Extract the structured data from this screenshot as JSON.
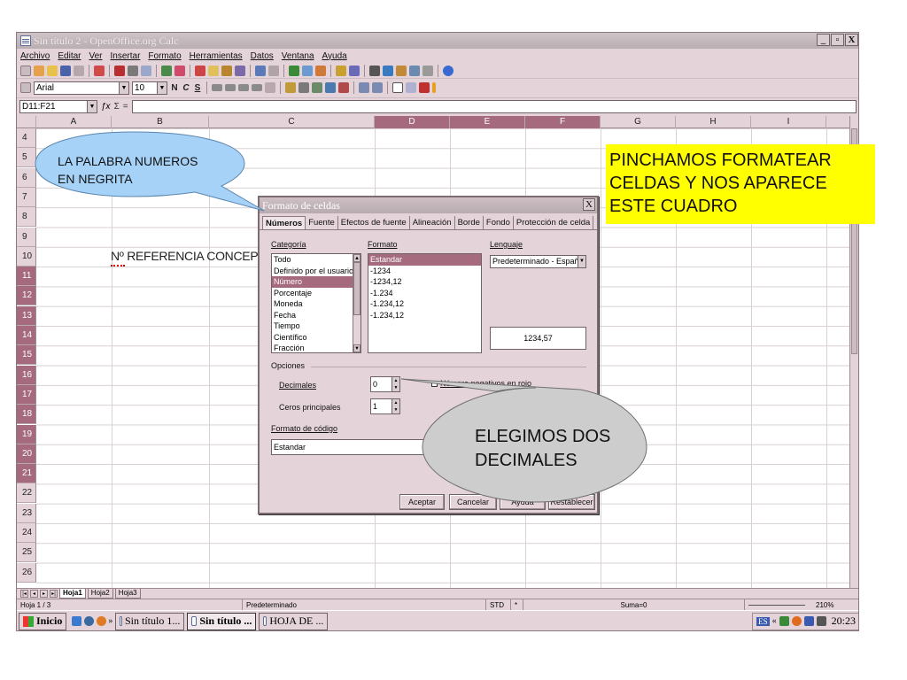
{
  "window": {
    "title": "Sin título 2 - OpenOffice.org Calc",
    "buttons": [
      "_",
      "▫",
      "X"
    ]
  },
  "menu": [
    "Archivo",
    "Editar",
    "Ver",
    "Insertar",
    "Formato",
    "Herramientas",
    "Datos",
    "Ventana",
    "Ayuda"
  ],
  "format_toolbar": {
    "font_name": "Arial",
    "font_size": "10",
    "bold": "N",
    "italic": "C",
    "underline": "S"
  },
  "formula_bar": {
    "name_box": "D11:F21",
    "fx": "ƒx",
    "sum": "Σ",
    "equals": "=",
    "value": ""
  },
  "columns": [
    "A",
    "B",
    "C",
    "D",
    "E",
    "F",
    "G",
    "H",
    "I"
  ],
  "rows": [
    "4",
    "5",
    "6",
    "7",
    "8",
    "9",
    "10",
    "11",
    "12",
    "13",
    "14",
    "15",
    "16",
    "17",
    "18",
    "19",
    "20",
    "21",
    "22",
    "23",
    "24",
    "25",
    "26"
  ],
  "cell_text": "Nº REFERENCIA CONCEP",
  "sheet_tabs": [
    "Hoja1",
    "Hoja2",
    "Hoja3"
  ],
  "status": {
    "sheet": "Hoja 1 / 3",
    "style": "Predeterminado",
    "mode": "STD",
    "mode_flag": "*",
    "sum": "Suma=0",
    "zoom": "210%"
  },
  "taskbar": {
    "start": "Inicio",
    "quicklaunch_more": "»",
    "tasks": [
      "Sin título 1...",
      "Sin título ...",
      "HOJA DE ..."
    ],
    "lang": "ES",
    "tray_more": "«",
    "clock": "20:23"
  },
  "dialog": {
    "title": "Formato de celdas",
    "close": "X",
    "tabs": [
      "Números",
      "Fuente",
      "Efectos de fuente",
      "Alineación",
      "Borde",
      "Fondo",
      "Protección de celda"
    ],
    "category_label": "Categoría",
    "categories": [
      "Todo",
      "Definido por el usuario",
      "Número",
      "Porcentaje",
      "Moneda",
      "Fecha",
      "Tiempo",
      "Científico",
      "Fracción"
    ],
    "category_selected": "Número",
    "format_label": "Formato",
    "formats": [
      "Estandar",
      "-1234",
      "-1234,12",
      "-1.234",
      "-1.234,12",
      "-1.234,12"
    ],
    "format_selected": "Estandar",
    "language_label": "Lenguaje",
    "language_value": "Predeterminado - Español",
    "preview": "1234,57",
    "options_label": "Opciones",
    "decimals_label": "Decimales",
    "decimals_value": "0",
    "negative_red_label": "Número negativos en rojo",
    "leading_zeros_label": "Ceros principales",
    "leading_zeros_value": "1",
    "code_label": "Formato de código",
    "code_value": "Estandar",
    "buttons": [
      "Aceptar",
      "Cancelar",
      "Ayuda",
      "Restablecer"
    ]
  },
  "annotations": {
    "bubble_top": [
      "LA PALABRA NUMEROS",
      "EN NEGRITA"
    ],
    "yellow_box": [
      "PINCHAMOS FORMATEAR",
      "CELDAS Y NOS APARECE",
      "ESTE CUADRO"
    ],
    "bubble_bottom": [
      "ELEGIMOS DOS",
      "DECIMALES"
    ]
  },
  "colors": {
    "chrome": "#e4d3d8",
    "selection": "#a56a7e",
    "bubble_blue": "#a6d2f7",
    "bubble_gray": "#cdcdcd",
    "callout_yellow": "#ffff00"
  }
}
